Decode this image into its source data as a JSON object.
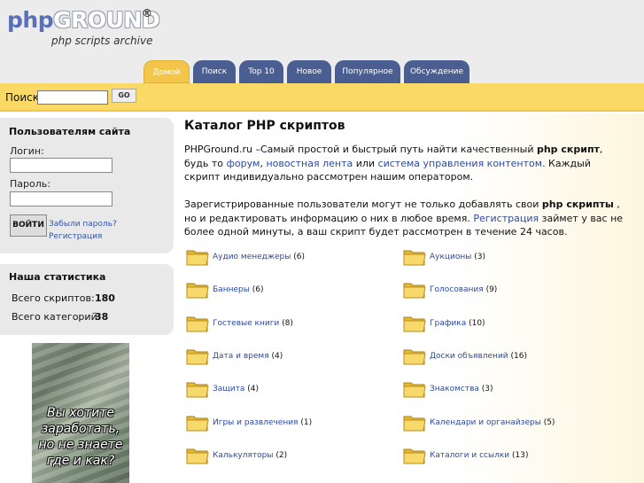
{
  "logo": {
    "php": "php",
    "ground": "GROUND",
    "reg": "®",
    "subtitle": "php scripts archive"
  },
  "tabs": [
    {
      "label": "Домой",
      "active": true
    },
    {
      "label": "Поиск"
    },
    {
      "label": "Top 10"
    },
    {
      "label": "Новое"
    },
    {
      "label": "Популярное"
    },
    {
      "label": "Обсуждение"
    }
  ],
  "search": {
    "label": "Поиск",
    "value": "",
    "go_label": "GO"
  },
  "login": {
    "title": "Пользователям сайта",
    "login_label": "Логин:",
    "password_label": "Пароль:",
    "button_label": "ВОЙТИ",
    "forgot_text": "Забыли пароль? Регистрация"
  },
  "stats": {
    "title": "Наша статистика",
    "scripts_label": "Всего скриптов:",
    "scripts_value": "180",
    "categories_label": "Всего категорий:",
    "categories_value": "38"
  },
  "banner": {
    "text": "Вы хотите заработать, но не знаете где и как?"
  },
  "main": {
    "title": "Каталог PHP скриптов",
    "p1": {
      "site": "PHPGround.ru",
      "t1": " –Самый простой и быстрый путь найти качественный ",
      "bold1": "php скрипт",
      "t2": ", будь то ",
      "link1": "форум",
      "t3": ", ",
      "link2": "новостная лента",
      "t4": " или ",
      "link3": "система управления контентом",
      "t5": ". Каждый скрипт индивидуально рассмотрен нашим оператором."
    },
    "p2": {
      "t1": "Зарегистрированные пользователи могут не только добавлять свои ",
      "bold1": "php скрипты",
      "t2": " , но и редактировать информацию о них в любое время. ",
      "link1": "Регистрация",
      "t3": " займет у вас не более одной минуты, а ваш скрипт будет рассмотрен в течение 24 часов."
    }
  },
  "categories": [
    {
      "name": "Аудио менеджеры",
      "count": "(6)"
    },
    {
      "name": "Аукционы",
      "count": "(3)"
    },
    {
      "name": "Баннеры",
      "count": "(6)"
    },
    {
      "name": "Голосования",
      "count": "(9)"
    },
    {
      "name": "Гостевые книги",
      "count": "(8)"
    },
    {
      "name": "Графика",
      "count": "(10)"
    },
    {
      "name": "Дата и время",
      "count": "(4)"
    },
    {
      "name": "Доски объявлений",
      "count": "(16)"
    },
    {
      "name": "Защита",
      "count": "(4)"
    },
    {
      "name": "Знакомства",
      "count": "(3)"
    },
    {
      "name": "Игры и развлечения",
      "count": "(1)"
    },
    {
      "name": "Календари и органайзеры",
      "count": "(5)"
    },
    {
      "name": "Калькуляторы",
      "count": "(2)"
    },
    {
      "name": "Каталоги и ссылки",
      "count": "(13)"
    }
  ],
  "colors": {
    "tab": "#4a5e92",
    "tab_active": "#f3c64b",
    "search_bar": "#fbd967",
    "link": "#2c4a9c"
  }
}
